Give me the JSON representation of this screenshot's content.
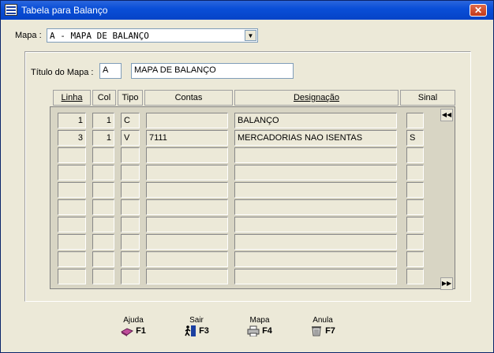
{
  "window": {
    "title": "Tabela para Balanço"
  },
  "mapa": {
    "label": "Mapa :",
    "value": "A - MAPA DE BALANÇO"
  },
  "titulo": {
    "label": "Título do Mapa :",
    "code": "A",
    "name": "MAPA DE BALANÇO"
  },
  "table": {
    "headers": [
      "Linha",
      "Col",
      "Tipo",
      "Contas",
      "Designação",
      "Sinal"
    ],
    "rows": [
      {
        "linha": "1",
        "col": "1",
        "tipo": "C",
        "contas": "",
        "designacao": "BALANÇO",
        "sinal": ""
      },
      {
        "linha": "3",
        "col": "1",
        "tipo": "V",
        "contas": "7111",
        "designacao": "MERCADORIAS NAO ISENTAS",
        "sinal": "S"
      },
      {
        "linha": "",
        "col": "",
        "tipo": "",
        "contas": "",
        "designacao": "",
        "sinal": ""
      },
      {
        "linha": "",
        "col": "",
        "tipo": "",
        "contas": "",
        "designacao": "",
        "sinal": ""
      },
      {
        "linha": "",
        "col": "",
        "tipo": "",
        "contas": "",
        "designacao": "",
        "sinal": ""
      },
      {
        "linha": "",
        "col": "",
        "tipo": "",
        "contas": "",
        "designacao": "",
        "sinal": ""
      },
      {
        "linha": "",
        "col": "",
        "tipo": "",
        "contas": "",
        "designacao": "",
        "sinal": ""
      },
      {
        "linha": "",
        "col": "",
        "tipo": "",
        "contas": "",
        "designacao": "",
        "sinal": ""
      },
      {
        "linha": "",
        "col": "",
        "tipo": "",
        "contas": "",
        "designacao": "",
        "sinal": ""
      },
      {
        "linha": "",
        "col": "",
        "tipo": "",
        "contas": "",
        "designacao": "",
        "sinal": ""
      }
    ]
  },
  "buttons": {
    "ajuda": {
      "label": "Ajuda",
      "key": "F1",
      "icon": "book-icon"
    },
    "sair": {
      "label": "Sair",
      "key": "F3",
      "icon": "exit-door-icon"
    },
    "mapa": {
      "label": "Mapa",
      "key": "F4",
      "icon": "printer-icon"
    },
    "anula": {
      "label": "Anula",
      "key": "F7",
      "icon": "trash-icon"
    }
  },
  "colors": {
    "titlebar": "#0543c7",
    "face": "#ece9d8",
    "close": "#c1391a"
  }
}
